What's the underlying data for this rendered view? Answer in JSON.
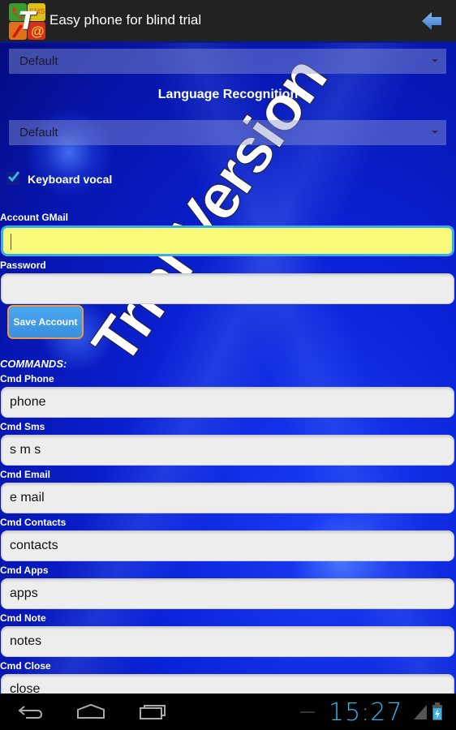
{
  "action_bar": {
    "title": "Easy phone for blind trial",
    "app_icon": {
      "name": "easy-phone-app-icon",
      "letter": "T",
      "tiles": [
        "phone-icon",
        "sms-icon",
        "pen-icon",
        "at-sign-icon"
      ],
      "sms_text": "SMS",
      "at_text": "@"
    },
    "back_icon": "back-arrow-icon"
  },
  "watermark": "Trial Version",
  "settings": {
    "voice_spinner": {
      "selected": "Default"
    },
    "language_recognition_label": "Language Recognition",
    "language_spinner": {
      "selected": "Default"
    },
    "keyboard_vocal": {
      "label": "Keyboard vocal",
      "checked": true
    },
    "account": {
      "label": "Account GMail",
      "value": "",
      "focused": true
    },
    "password": {
      "label": "Password",
      "value": ""
    },
    "save_button": "Save Account",
    "commands_header": "COMMANDS:",
    "commands": [
      {
        "label": "Cmd Phone",
        "value": "phone"
      },
      {
        "label": "Cmd Sms",
        "value": "s m s"
      },
      {
        "label": "Cmd Email",
        "value": "e mail"
      },
      {
        "label": "Cmd Contacts",
        "value": "contacts"
      },
      {
        "label": "Cmd Apps",
        "value": "apps"
      },
      {
        "label": "Cmd Note",
        "value": "notes"
      },
      {
        "label": "Cmd Close",
        "value": "close"
      }
    ]
  },
  "nav_bar": {
    "buttons": [
      "back-icon",
      "home-icon",
      "recent-apps-icon"
    ],
    "time": "15:27",
    "signal_icon": "signal-icon",
    "battery_icon": "battery-charging-icon"
  },
  "colors": {
    "accent": "#33b5e5",
    "focused_input_bg": "#f9f97a",
    "focused_input_border": "#38aee8",
    "save_button_border": "#f09a40",
    "save_button_bg": "#4aa8f0",
    "background_blue": "#0a22d8"
  }
}
